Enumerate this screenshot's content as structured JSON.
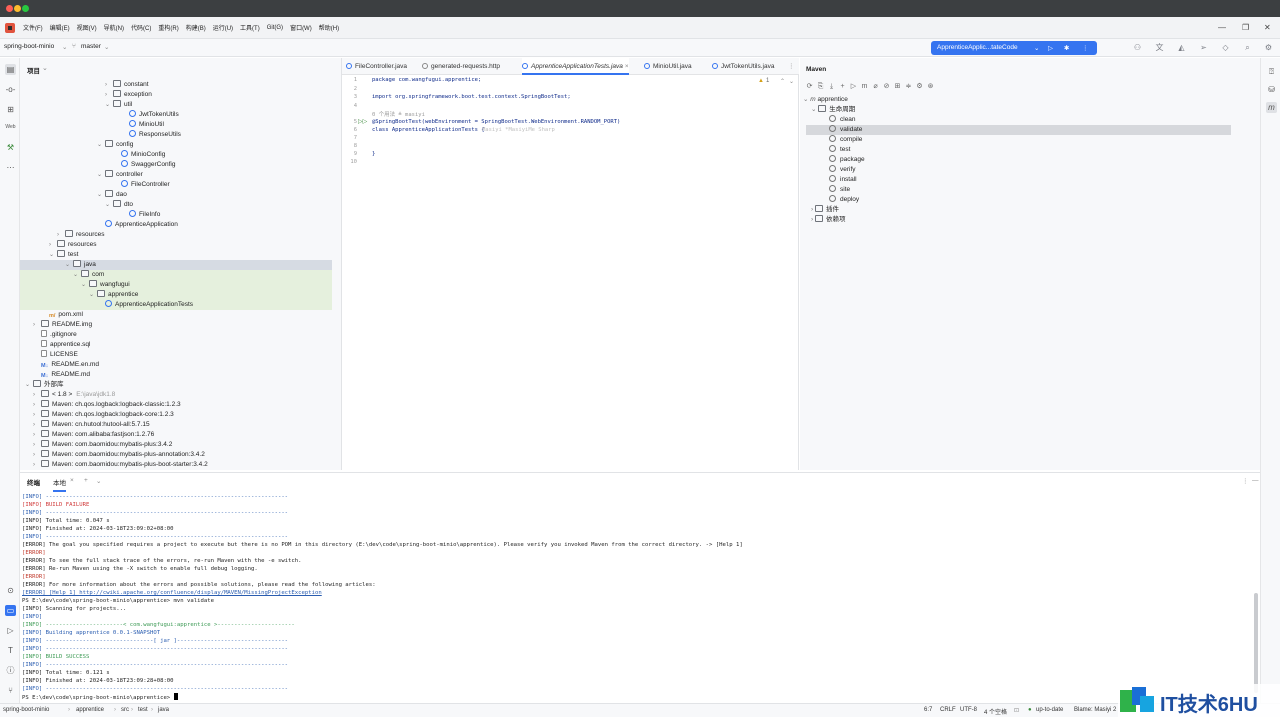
{
  "menu": [
    "文件(F)",
    "编辑(E)",
    "视图(V)",
    "导航(N)",
    "代码(C)",
    "重构(R)",
    "构建(B)",
    "运行(U)",
    "工具(T)",
    "Git(G)",
    "窗口(W)",
    "帮助(H)"
  ],
  "nav": {
    "project": "spring-boot-minio",
    "branch": "master",
    "run_config": "ApprenticeApplic...tateCode"
  },
  "project_panel": {
    "title": "项目",
    "rows": [
      {
        "label": "constant",
        "kind": "folder"
      },
      {
        "label": "exception",
        "kind": "folder"
      },
      {
        "label": "util",
        "kind": "folder"
      },
      {
        "label": "JwtTokenUtils",
        "kind": "java"
      },
      {
        "label": "MinioUtil",
        "kind": "java"
      },
      {
        "label": "ResponseUtils",
        "kind": "java"
      },
      {
        "label": "config",
        "kind": "folder"
      },
      {
        "label": "MinioConfig",
        "kind": "java"
      },
      {
        "label": "SwaggerConfig",
        "kind": "java"
      },
      {
        "label": "controller",
        "kind": "folder"
      },
      {
        "label": "FileController",
        "kind": "java"
      },
      {
        "label": "dao",
        "kind": "folder"
      },
      {
        "label": "dto",
        "kind": "folder"
      },
      {
        "label": "FileInfo",
        "kind": "java"
      },
      {
        "label": "ApprenticeApplication",
        "kind": "java"
      },
      {
        "label": "resources",
        "kind": "folder"
      },
      {
        "label": "resources",
        "kind": "folder"
      },
      {
        "label": "test",
        "kind": "folder"
      },
      {
        "label": "java",
        "kind": "folder"
      },
      {
        "label": "com",
        "kind": "folder"
      },
      {
        "label": "wangfugui",
        "kind": "folder"
      },
      {
        "label": "apprentice",
        "kind": "folder"
      },
      {
        "label": "ApprenticeApplicationTests",
        "kind": "java"
      },
      {
        "label": "pom.xml",
        "kind": "xml"
      },
      {
        "label": "README.img",
        "kind": "folder"
      },
      {
        "label": ".gitignore",
        "kind": "file"
      },
      {
        "label": "apprentice.sql",
        "kind": "file"
      },
      {
        "label": "LICENSE",
        "kind": "file"
      },
      {
        "label": "README.en.md",
        "kind": "md"
      },
      {
        "label": "README.md",
        "kind": "md"
      },
      {
        "label": "外部库",
        "kind": "folder"
      },
      {
        "label": "< 1.8 >",
        "kind": "folder",
        "hint": "E:\\java\\jdk1.8"
      },
      {
        "label": "Maven: ch.qos.logback:logback-classic:1.2.3",
        "kind": "folder"
      },
      {
        "label": "Maven: ch.qos.logback:logback-core:1.2.3",
        "kind": "folder"
      },
      {
        "label": "Maven: cn.hutool:hutool-all:5.7.15",
        "kind": "folder"
      },
      {
        "label": "Maven: com.alibaba:fastjson:1.2.76",
        "kind": "folder"
      },
      {
        "label": "Maven: com.baomidou:mybatis-plus:3.4.2",
        "kind": "folder"
      },
      {
        "label": "Maven: com.baomidou:mybatis-plus-annotation:3.4.2",
        "kind": "folder"
      },
      {
        "label": "Maven: com.baomidou:mybatis-plus-boot-starter:3.4.2",
        "kind": "folder"
      }
    ]
  },
  "editor": {
    "tabs": [
      "FileController.java",
      "generated-requests.http",
      "ApprenticeApplicationTests.java",
      "MinioUtil.java",
      "JwtTokenUtils.java"
    ],
    "warning_count": "1",
    "lines": [
      {
        "n": "1",
        "text": "package com.wangfugui.apprentice;"
      },
      {
        "n": "2",
        "text": ""
      },
      {
        "n": "3",
        "text": "import org.springframework.boot.test.context.SpringBootTest;"
      },
      {
        "n": "4",
        "text": ""
      },
      {
        "n": "5",
        "text": "@SpringBootTest(webEnvironment = SpringBootTest.WebEnvironment.RANDOM_PORT)"
      },
      {
        "n": "6",
        "text": "class ApprenticeApplicationTests {"
      },
      {
        "n": "7",
        "text": ""
      },
      {
        "n": "8",
        "text": ""
      },
      {
        "n": "9",
        "text": "}"
      },
      {
        "n": "10",
        "text": ""
      }
    ],
    "usage_hint": "0 个用法   ≗ masiyi",
    "author_hint": "Masiyi *MasiyiMe Sharp"
  },
  "maven": {
    "title": "Maven",
    "project": "apprentice",
    "lifecycle": "生命周期",
    "goals": [
      "clean",
      "validate",
      "compile",
      "test",
      "package",
      "verify",
      "install",
      "site",
      "deploy"
    ],
    "plugins": "插件",
    "dependencies": "依赖项"
  },
  "terminal": {
    "tabs": [
      "终端",
      "本地"
    ],
    "lines": [
      {
        "cls": "t-info",
        "text": "[INFO] ------------------------------------------------------------------------"
      },
      {
        "cls": "t-red",
        "text": "[INFO] BUILD FAILURE"
      },
      {
        "cls": "t-info",
        "text": "[INFO] ------------------------------------------------------------------------"
      },
      {
        "cls": "",
        "text": "[INFO] Total time:  0.047 s"
      },
      {
        "cls": "",
        "text": "[INFO] Finished at: 2024-03-18T23:09:02+08:00"
      },
      {
        "cls": "t-info",
        "text": "[INFO] ------------------------------------------------------------------------"
      },
      {
        "cls": "",
        "text": "[ERROR] The goal you specified requires a project to execute but there is no POM in this directory (E:\\dev\\code\\spring-boot-minio\\apprentice). Please verify you invoked Maven from the correct directory. -> [Help 1]"
      },
      {
        "cls": "t-err",
        "text": "[ERROR]"
      },
      {
        "cls": "",
        "text": "[ERROR] To see the full stack trace of the errors, re-run Maven with the -e switch."
      },
      {
        "cls": "",
        "text": "[ERROR] Re-run Maven using the -X switch to enable full debug logging."
      },
      {
        "cls": "t-err",
        "text": "[ERROR]"
      },
      {
        "cls": "",
        "text": "[ERROR] For more information about the errors and possible solutions, please read the following articles:"
      },
      {
        "cls": "t-link",
        "text": "[ERROR] [Help 1] http://cwiki.apache.org/confluence/display/MAVEN/MissingProjectException"
      },
      {
        "cls": "",
        "text": "PS E:\\dev\\code\\spring-boot-minio\\apprentice> mvn validate"
      },
      {
        "cls": "",
        "text": "[INFO] Scanning for projects..."
      },
      {
        "cls": "t-info",
        "text": "[INFO]"
      },
      {
        "cls": "t-green",
        "text": "[INFO] -----------------------< com.wangfugui:apprentice >-----------------------"
      },
      {
        "cls": "t-info",
        "text": "[INFO] Building apprentice 0.0.1-SNAPSHOT"
      },
      {
        "cls": "t-info",
        "text": "[INFO] --------------------------------[ jar ]---------------------------------"
      },
      {
        "cls": "t-info",
        "text": "[INFO] ------------------------------------------------------------------------"
      },
      {
        "cls": "t-green",
        "text": "[INFO] BUILD SUCCESS"
      },
      {
        "cls": "t-info",
        "text": "[INFO] ------------------------------------------------------------------------"
      },
      {
        "cls": "",
        "text": "[INFO] Total time:  0.121 s"
      },
      {
        "cls": "",
        "text": "[INFO] Finished at: 2024-03-18T23:09:28+08:00"
      },
      {
        "cls": "t-info",
        "text": "[INFO] ------------------------------------------------------------------------"
      },
      {
        "cls": "",
        "text": "PS E:\\dev\\code\\spring-boot-minio\\apprentice> "
      }
    ]
  },
  "status": {
    "path": [
      "spring-boot-minio",
      "apprentice",
      "src",
      "test",
      "java"
    ],
    "position": "6:7",
    "line_sep": "CRLF",
    "encoding": "UTF-8",
    "indent": "4 个空格",
    "vcs": "up-to-date",
    "blame": "Blame: Masiyi 2"
  },
  "watermark": "IT技术6HU",
  "colors": {
    "accent": "#3574f0",
    "titlebar": "#3c3f41",
    "selection": "#d6dbe3",
    "highlight": "#e5f0dd"
  }
}
